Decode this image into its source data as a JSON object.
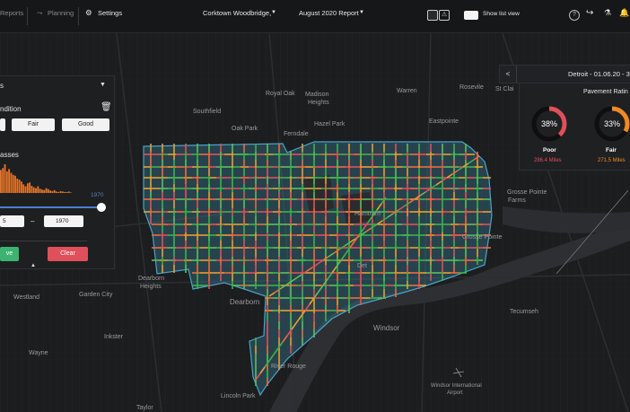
{
  "topbar": {
    "reports_label": "Reports",
    "planning_label": "Planning",
    "settings_label": "Settings",
    "location": "Corktown Woodbridge,",
    "report": "August 2020 Report",
    "show_list_label": "Show list view"
  },
  "map_labels": {
    "southfield": "Southfield",
    "royal_oak": "Royal Oak",
    "madison_heights_1": "Madison",
    "madison_heights_2": "Heights",
    "warren": "Warren",
    "roseville": "Rosevile",
    "st_clair": "St Clai",
    "oak_park": "Oak Park",
    "ferndale": "Ferndale",
    "hazel_park": "Hazel Park",
    "eastpointe": "Eastpointe",
    "hamtramck": "Hamtram",
    "detroit": "Det",
    "grosse_pointe_1": "Grosse Pointe",
    "grosse_pointe_2": "Farms",
    "grosse_pointe_park": "Grosse Pointe",
    "westland": "Westland",
    "garden_city": "Garden City",
    "dearborn_heights_1": "Dearborn",
    "dearborn_heights_2": "Heights",
    "dearborn": "Dearborn",
    "windsor": "Windsor",
    "tecumseh": "Tecumseh",
    "inkster": "Inkster",
    "wayne": "Wayne",
    "river_rouge": "River Rouge",
    "lincoln_park": "Lincoln Park",
    "taylor": "Taylor",
    "airport_1": "Windsor International",
    "airport_2": "Airport"
  },
  "filter": {
    "title": "s",
    "condition_label": "ndition",
    "conditions": [
      "",
      "Fair",
      "Good"
    ],
    "classes_label": "asses",
    "year_slider_max": "1970",
    "range_from": "5",
    "range_dash": "–",
    "range_to": "1970",
    "apply_label": "ve",
    "clear_label": "Clear",
    "histogram": [
      48,
      52,
      60,
      45,
      50,
      42,
      38,
      36,
      30,
      28,
      24,
      18,
      14,
      20,
      22,
      15,
      12,
      10,
      14,
      9,
      7,
      6,
      10,
      8,
      5,
      4,
      6,
      3,
      2,
      4,
      3,
      2,
      2,
      3,
      1
    ],
    "colors": {
      "apply": "#3cb371",
      "clear": "#e0505a",
      "hist": "#e8762a"
    }
  },
  "right_panel": {
    "collapse_label": "<",
    "header": "Detroit - 01.06.20 - 31",
    "title": "Pavement Ratin",
    "ratings": [
      {
        "pct": "38%",
        "value": 38,
        "label": "Poor",
        "miles": "286.4 Miles",
        "color": "#e0505a"
      },
      {
        "pct": "33%",
        "value": 33,
        "label": "Fair",
        "miles": "271.5 Miles",
        "color": "#f08a24"
      }
    ]
  }
}
